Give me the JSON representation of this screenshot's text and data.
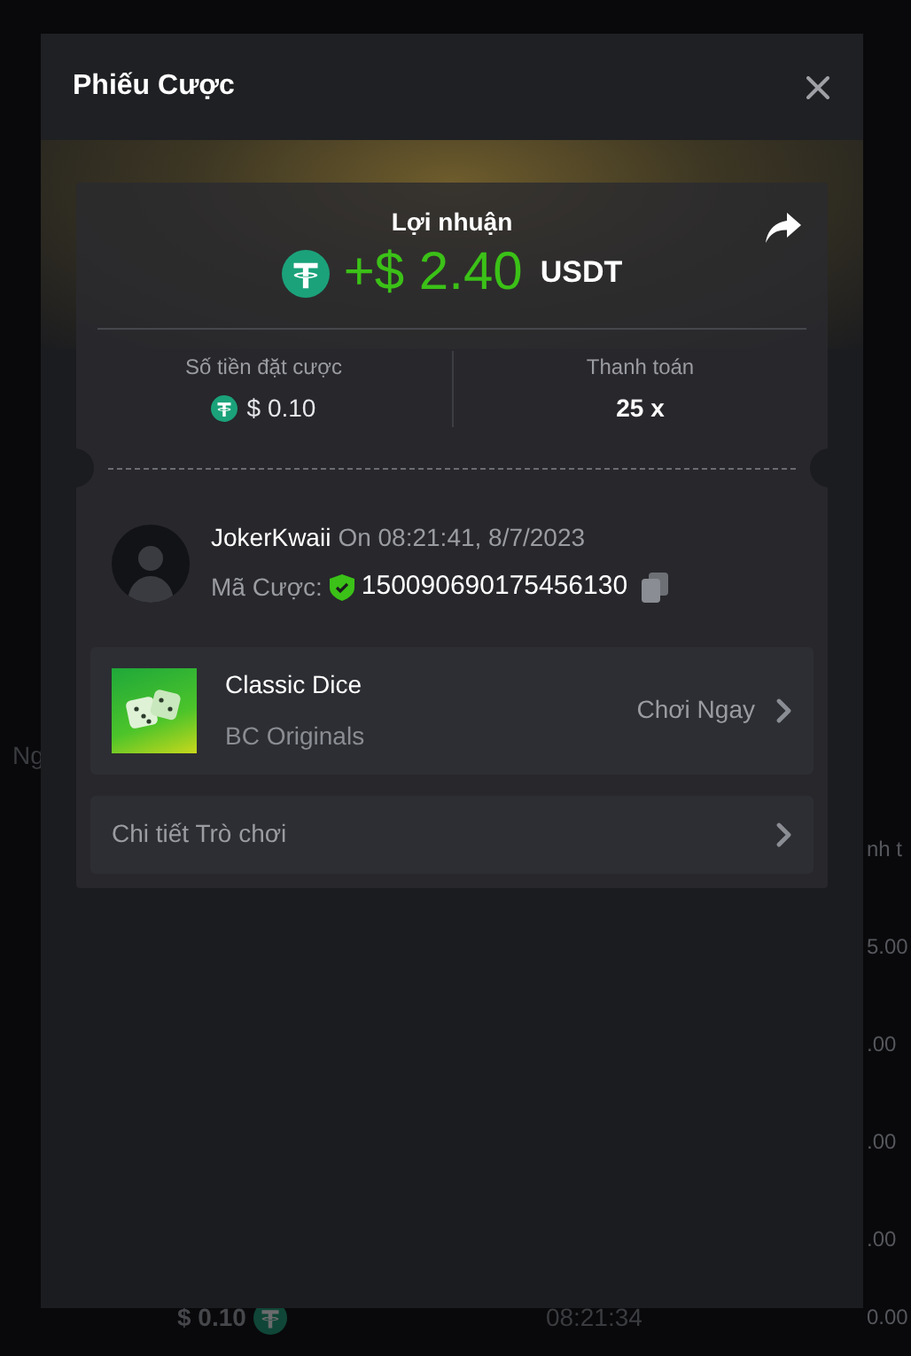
{
  "background": {
    "left_texts": [
      "Ng"
    ],
    "right_texts": [
      "nh t",
      "5.00",
      ".00",
      ".00",
      ".00"
    ],
    "bottom_row": {
      "amount": "$ 0.10",
      "time": "08:21:34",
      "payout": "0.00"
    }
  },
  "modal": {
    "title": "Phiếu Cược"
  },
  "profit": {
    "label": "Lợi nhuận",
    "amount": "+$ 2.40",
    "currency": "USDT"
  },
  "stats": [
    {
      "label": "Số tiền đặt cược",
      "value": "$ 0.10",
      "kind": "coin"
    },
    {
      "label": "Thanh toán",
      "value": "25 x",
      "kind": "plain"
    }
  ],
  "bet": {
    "user": "JokerKwaii",
    "time": "On 08:21:41, 8/7/2023",
    "id_label": "Mã Cược:",
    "id": "150090690175456130",
    "verified": true
  },
  "game": {
    "name": "Classic Dice",
    "provider": "BC Originals",
    "action": "Chơi Ngay"
  },
  "details": {
    "label": "Chi tiết Trò chơi"
  }
}
